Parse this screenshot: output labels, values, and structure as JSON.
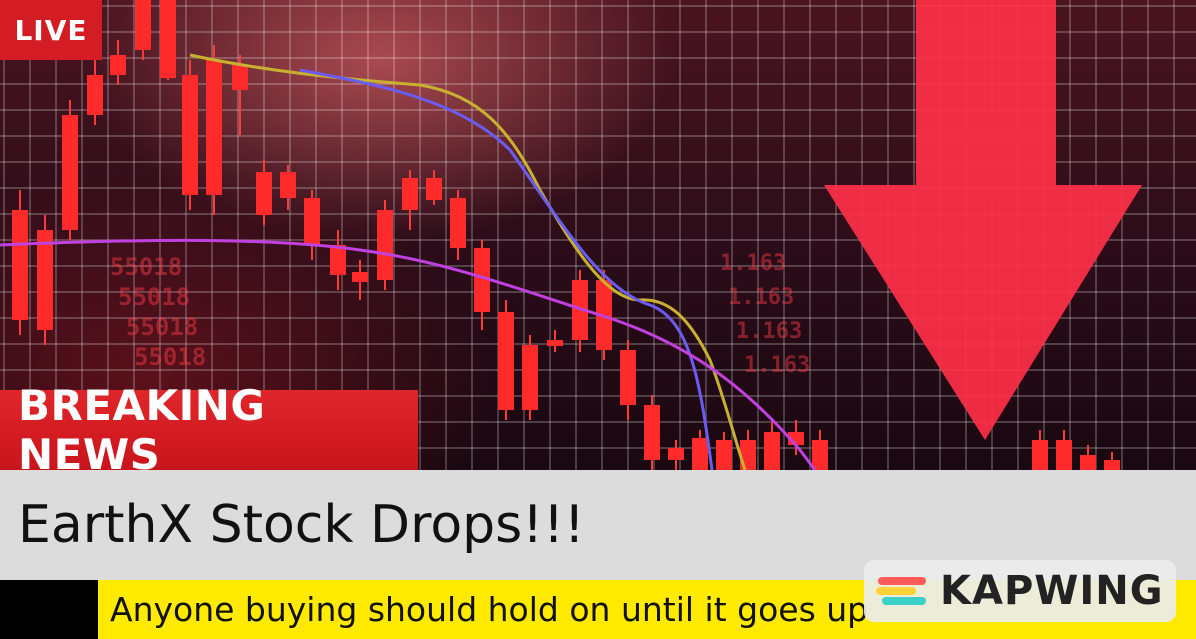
{
  "live_badge": {
    "label": "LIVE"
  },
  "breaking_banner": {
    "label": "BREAKING NEWS"
  },
  "headline": {
    "text": "EarthX Stock Drops!!!"
  },
  "ticker": {
    "text": "Anyone buying should hold on until it goes up"
  },
  "watermark": {
    "label": "KAPWING"
  },
  "background": {
    "ghost_numbers": [
      "55018",
      "55018",
      "55018",
      "55018"
    ],
    "ghost_numbers_right": [
      "1.163",
      "1.163",
      "1.163",
      "1.163"
    ]
  },
  "colors": {
    "live_red": "#d41c24",
    "breaking_red": "#d41c24",
    "headline_bg": "#dcdcdc",
    "ticker_bg": "#ffea00",
    "arrow_red": "#ff3048",
    "candle_red": "#ff2a2a"
  }
}
